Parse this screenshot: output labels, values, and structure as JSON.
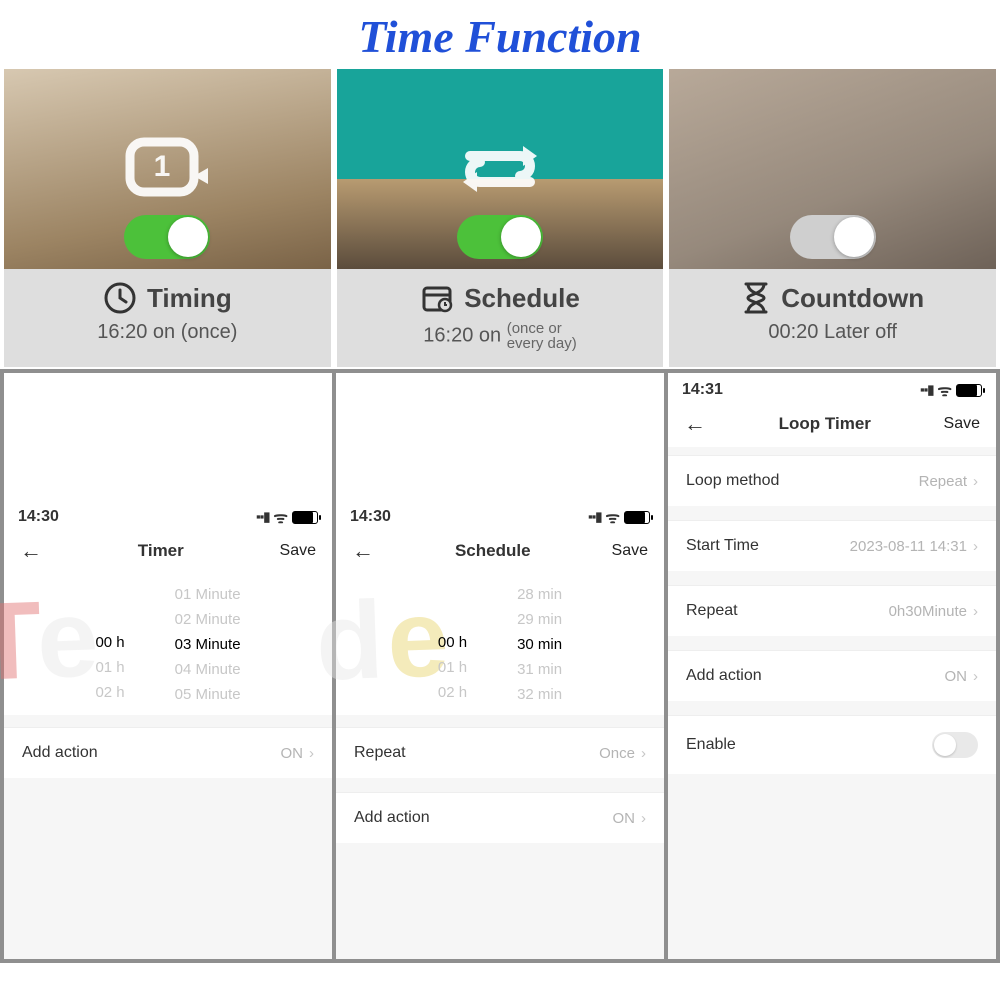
{
  "title": "Time Function",
  "cards": [
    {
      "label": "Timing",
      "sub_main": "16:20 on (once)",
      "sub_extra": "",
      "toggle": "on"
    },
    {
      "label": "Schedule",
      "sub_main": "16:20 on",
      "sub_extra": "(once or\nevery day)",
      "toggle": "on"
    },
    {
      "label": "Countdown",
      "sub_main": "00:20 Later off",
      "sub_extra": "",
      "toggle": "off"
    }
  ],
  "phones": {
    "timer": {
      "time": "14:30",
      "title": "Timer",
      "save": "Save",
      "picker_minutes": [
        "01 Minute",
        "02 Minute",
        "03 Minute",
        "04 Minute",
        "05 Minute"
      ],
      "picker_minutes_selected_index": 2,
      "picker_hours": [
        "00 h",
        "01 h",
        "02 h"
      ],
      "picker_hours_selected_index": 0,
      "rows": [
        {
          "label": "Add action",
          "value": "ON"
        }
      ]
    },
    "schedule": {
      "time": "14:30",
      "title": "Schedule",
      "save": "Save",
      "picker_minutes": [
        "28 min",
        "29 min",
        "30 min",
        "31 min",
        "32 min"
      ],
      "picker_minutes_selected_index": 2,
      "picker_hours": [
        "00 h",
        "01 h",
        "02 h"
      ],
      "picker_hours_selected_index": 0,
      "rows": [
        {
          "label": "Repeat",
          "value": "Once"
        },
        {
          "label": "Add action",
          "value": "ON"
        }
      ]
    },
    "loop": {
      "time": "14:31",
      "title": "Loop Timer",
      "save": "Save",
      "rows": [
        {
          "label": "Loop method",
          "value": "Repeat"
        },
        {
          "label": "Start Time",
          "value": "2023-08-11 14:31"
        },
        {
          "label": "Repeat",
          "value": "0h30Minute"
        },
        {
          "label": "Add action",
          "value": "ON"
        }
      ],
      "enable_label": "Enable"
    }
  }
}
